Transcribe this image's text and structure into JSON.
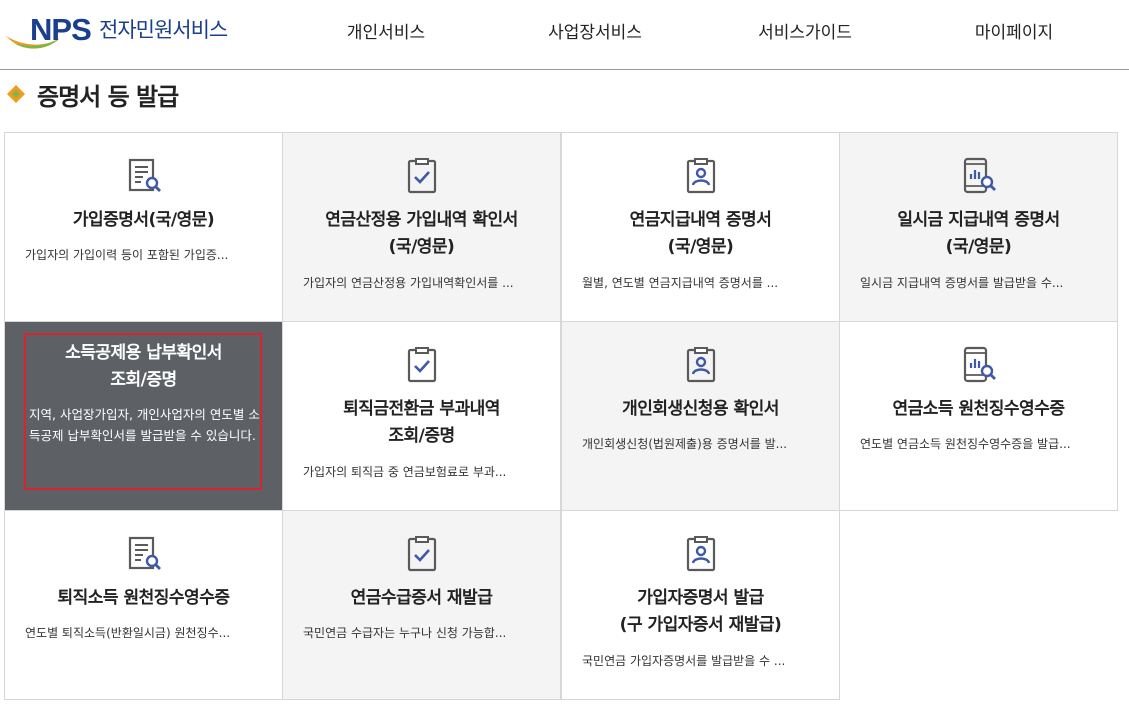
{
  "header": {
    "logo_brand": "NPS",
    "logo_text": "전자민원서비스",
    "nav": [
      "개인서비스",
      "사업장서비스",
      "서비스가이드",
      "마이페이지"
    ]
  },
  "page": {
    "title": "증명서 등 발급"
  },
  "colors": {
    "brand_blue": "#1b3f8f",
    "accent_orange": "#f39a1e",
    "accent_green": "#7ab648",
    "active_card_bg": "#5d6166",
    "focus_border": "#d9242f",
    "icon_gray": "#5a5a5a",
    "icon_blue": "#3f59a6"
  },
  "cards": [
    {
      "icon": "document-search-icon",
      "title_lines": [
        "가입증명서(국/영문)"
      ],
      "desc": "가입자의 가입이력 등이 포함된 가입증..."
    },
    {
      "icon": "clipboard-check-icon",
      "title_lines": [
        "연금산정용 가입내역 확인서",
        "(국/영문)"
      ],
      "desc": "가입자의 연금산정용 가입내역확인서를 ..."
    },
    {
      "icon": "clipboard-person-icon",
      "title_lines": [
        "연금지급내역 증명서",
        "(국/영문)"
      ],
      "desc": "월별, 연도별 연금지급내역 증명서를 ..."
    },
    {
      "icon": "mobile-chart-search-icon",
      "title_lines": [
        "일시금 지급내역 증명서",
        "(국/영문)"
      ],
      "desc": "일시금 지급내역 증명서를 발급받을 수..."
    },
    {
      "icon": "",
      "title_lines": [
        "소득공제용 납부확인서",
        "조회/증명"
      ],
      "desc": "지역, 사업장가입자, 개인사업자의 연도별 소득공제 납부확인서를 발급받을 수 있습니다."
    },
    {
      "icon": "clipboard-check-icon",
      "title_lines": [
        "퇴직금전환금 부과내역",
        "조회/증명"
      ],
      "desc": "가입자의 퇴직금 중 연금보험료로 부과..."
    },
    {
      "icon": "clipboard-person-icon",
      "title_lines": [
        "개인회생신청용 확인서"
      ],
      "desc": "개인회생신청(법원제출)용 증명서를 발..."
    },
    {
      "icon": "mobile-chart-search-icon",
      "title_lines": [
        "연금소득 원천징수영수증"
      ],
      "desc": "연도별 연금소득 원천징수영수증을 발급..."
    },
    {
      "icon": "document-search-icon",
      "title_lines": [
        "퇴직소득 원천징수영수증"
      ],
      "desc": "연도별 퇴직소득(반환일시금) 원천징수..."
    },
    {
      "icon": "clipboard-check-icon",
      "title_lines": [
        "연금수급증서 재발급"
      ],
      "desc": "국민연금 수급자는 누구나 신청 가능합..."
    },
    {
      "icon": "clipboard-person-icon",
      "title_lines": [
        "가입자증명서 발급",
        "(구 가입자증서 재발급)"
      ],
      "desc": "국민연금 가입자증명서를 발급받을 수 ..."
    }
  ]
}
